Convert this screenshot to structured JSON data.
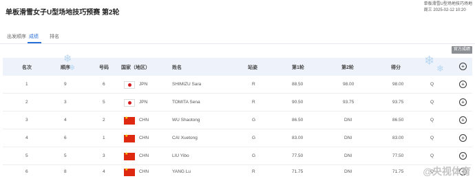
{
  "page": {
    "title": "单板滑雪女子U型场地技巧预赛 第2轮",
    "venue_line1": "单板滑雪U型场地技巧场地",
    "venue_line2": "周三 2025-02-12 10:20"
  },
  "tabs": [
    {
      "label": "出发顺序",
      "active": false
    },
    {
      "label": "成绩",
      "active": true
    },
    {
      "label": "排名",
      "active": false
    }
  ],
  "official_badge": "官方成绩",
  "columns": {
    "rank": "名次",
    "order": "顺序",
    "bib": "号码",
    "nation": "国家（地区）",
    "name": "姓名",
    "stance": "站姿",
    "run1": "第1轮",
    "run2": "第2轮",
    "score": "得分"
  },
  "rows": [
    {
      "rank": "1",
      "order": "9",
      "bib": "6",
      "flag": "jpn",
      "nation": "JPN",
      "name": "SHIMIZU Sara",
      "stance": "R",
      "run1": "88.50",
      "run2": "98.00",
      "score": "98.00",
      "q": "Q"
    },
    {
      "rank": "2",
      "order": "3",
      "bib": "5",
      "flag": "jpn",
      "nation": "JPN",
      "name": "TOMITA Sena",
      "stance": "R",
      "run1": "90.50",
      "run2": "93.75",
      "score": "93.75",
      "q": "Q"
    },
    {
      "rank": "3",
      "order": "4",
      "bib": "2",
      "flag": "chn",
      "nation": "CHN",
      "name": "WU Shaotong",
      "stance": "G",
      "run1": "86.50",
      "run2": "DNI",
      "score": "86.50",
      "q": "Q"
    },
    {
      "rank": "4",
      "order": "6",
      "bib": "1",
      "flag": "chn",
      "nation": "CHN",
      "name": "CAI Xuetong",
      "stance": "G",
      "run1": "83.00",
      "run2": "DNI",
      "score": "83.00",
      "q": "Q"
    },
    {
      "rank": "5",
      "order": "5",
      "bib": "3",
      "flag": "chn",
      "nation": "CHN",
      "name": "LIU Yibo",
      "stance": "G",
      "run1": "77.50",
      "run2": "DNI",
      "score": "77.50",
      "q": "Q"
    },
    {
      "rank": "6",
      "order": "8",
      "bib": "4",
      "flag": "chn",
      "nation": "CHN",
      "name": "YANG Lu",
      "stance": "R",
      "run1": "71.75",
      "run2": "DNI",
      "score": "71.75",
      "q": "Q"
    }
  ],
  "icons": {
    "expand": "plus-circle-icon",
    "snowflake": "snowflake-icon"
  },
  "watermark": "@央视体育",
  "colors": {
    "accent": "#2a6fd8",
    "header_bg": "#eef3fb",
    "jpn_red": "#d41a1f",
    "chn_red": "#de2910"
  }
}
